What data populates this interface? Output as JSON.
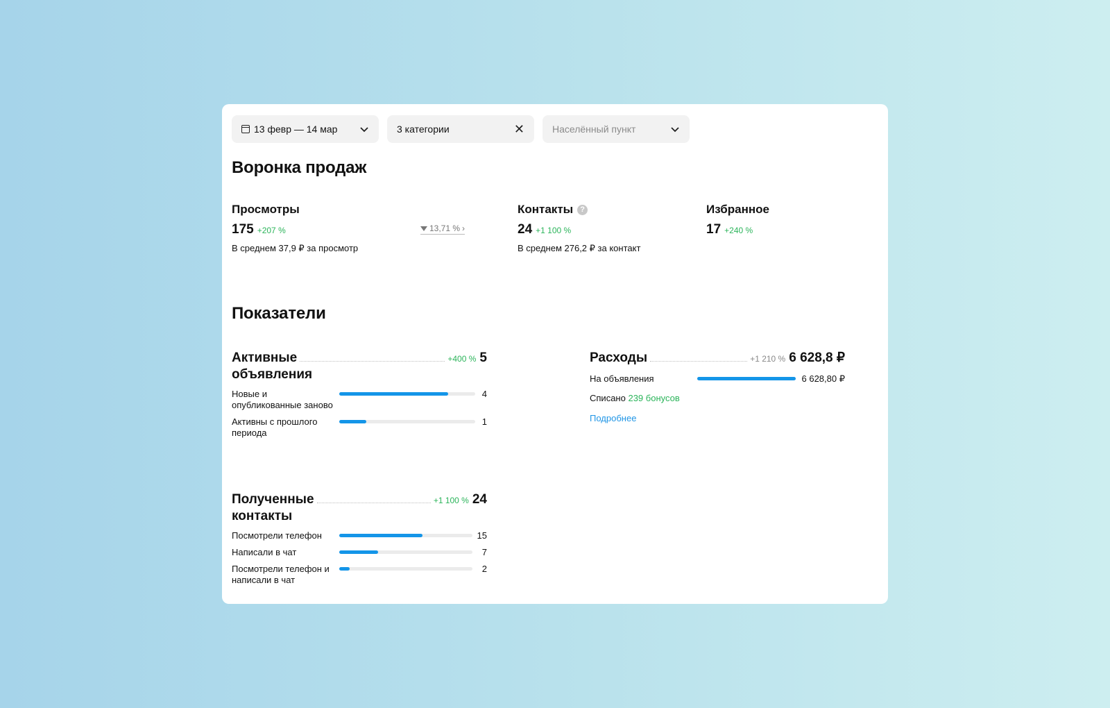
{
  "filters": {
    "date": "13 февр — 14 мар",
    "categories": "3 категории",
    "city_placeholder": "Населённый пункт"
  },
  "funnel": {
    "title": "Воронка продаж",
    "views": {
      "label": "Просмотры",
      "value": "175",
      "change": "+207 %",
      "avg": "В среднем 37,9 ₽ за просмотр",
      "conversion": "13,71 %"
    },
    "contacts": {
      "label": "Контакты",
      "value": "24",
      "change": "+1 100 %",
      "avg": "В среднем 276,2 ₽ за контакт"
    },
    "favorites": {
      "label": "Избранное",
      "value": "17",
      "change": "+240 %"
    }
  },
  "metrics": {
    "title": "Показатели",
    "active_ads": {
      "title_line1": "Активные",
      "title_line2": "объявления",
      "change": "+400 %",
      "total": "5",
      "rows": [
        {
          "label": "Новые и опубликованные заново",
          "value": "4",
          "fraction": 0.8
        },
        {
          "label": "Активны с прошлого периода",
          "value": "1",
          "fraction": 0.2
        }
      ]
    },
    "contacts": {
      "title_line1": "Полученные",
      "title_line2": "контакты",
      "change": "+1 100 %",
      "total": "24",
      "rows": [
        {
          "label": "Посмотрели телефон",
          "value": "15",
          "fraction": 0.625
        },
        {
          "label": "Написали в чат",
          "value": "7",
          "fraction": 0.29
        },
        {
          "label": "Посмотрели телефон и написали в чат",
          "value": "2",
          "fraction": 0.08
        }
      ]
    },
    "expenses": {
      "title": "Расходы",
      "change": "+1 210 %",
      "total": "6 628,8 ₽",
      "ads_label": "На объявления",
      "ads_value": "6 628,80 ₽",
      "ads_fraction": 1.0,
      "bonus_prefix": "Списано",
      "bonus_link": "239 бонусов",
      "more": "Подробнее"
    }
  },
  "colors": {
    "accent": "#1495e8",
    "positive": "#2bb45a",
    "link": "#2196e6"
  }
}
